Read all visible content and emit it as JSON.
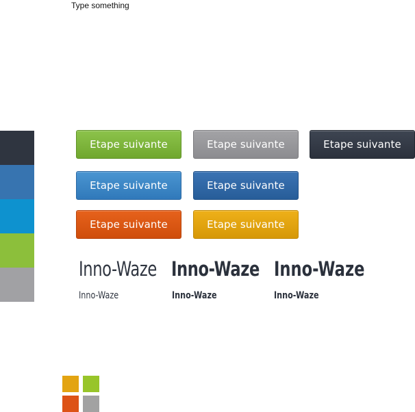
{
  "header": {
    "text": "Type something"
  },
  "palette": [
    {
      "name": "dark",
      "color": "#2f3540"
    },
    {
      "name": "blue",
      "color": "#3774b0"
    },
    {
      "name": "cyan",
      "color": "#0e92cf"
    },
    {
      "name": "green",
      "color": "#8cbf3b"
    },
    {
      "name": "grey",
      "color": "#a1a1a4"
    }
  ],
  "buttons": [
    {
      "label": "Etape suivante",
      "color": "#78b134"
    },
    {
      "label": "Etape suivante",
      "color": "#97979b"
    },
    {
      "label": "Etape suivante",
      "color": "#343b47"
    },
    {
      "label": "Etape suivante",
      "color": "#3b86c5"
    },
    {
      "label": "Etape suivante",
      "color": "#2f68a7"
    },
    {
      "label": "Etape suivante",
      "color": "#db5713"
    },
    {
      "label": "Etape suivante",
      "color": "#e1a30f"
    }
  ],
  "typography": [
    {
      "big": "Inno-Waze",
      "small": "Inno-Waze"
    },
    {
      "big": "Inno-Waze",
      "small": "Inno-Waze"
    },
    {
      "big": "Inno-Waze",
      "small": "Inno-Waze"
    }
  ],
  "logo_squares": [
    {
      "name": "yellow",
      "color": "#e3a412"
    },
    {
      "name": "green",
      "color": "#98c52a"
    },
    {
      "name": "orange",
      "color": "#dd5316"
    },
    {
      "name": "grey",
      "color": "#a2a2a2"
    }
  ]
}
